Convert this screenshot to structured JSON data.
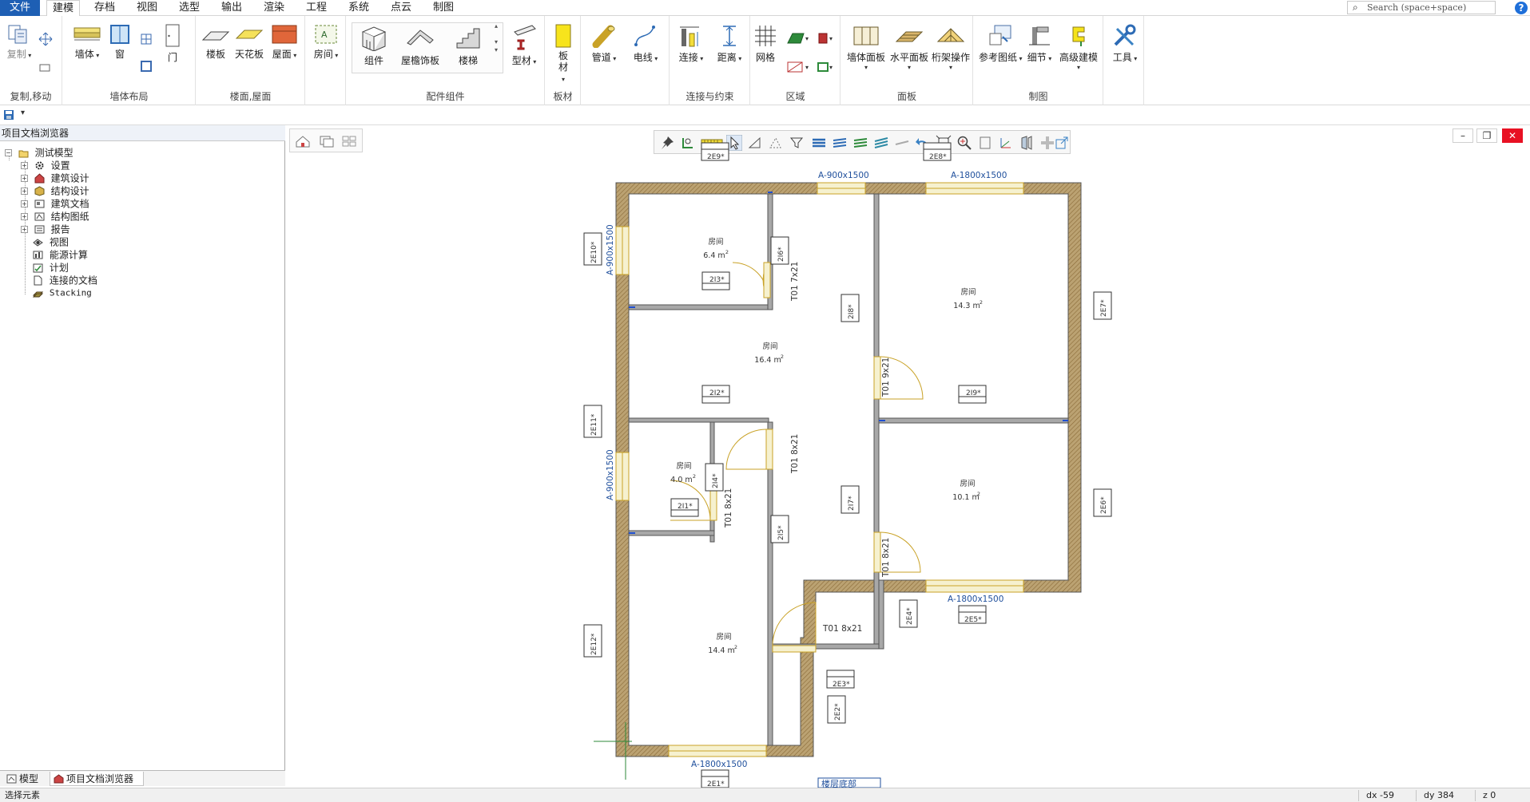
{
  "tabs": [
    "文件",
    "建模",
    "存档",
    "视图",
    "选型",
    "输出",
    "渲染",
    "工程",
    "系统",
    "点云",
    "制图"
  ],
  "active_tab": "建模",
  "search": {
    "placeholder": "Search (space+space)"
  },
  "ribbon": {
    "groups": {
      "copy_move": "复制,移动",
      "wall_layout": "墙体布局",
      "floor_roof": "楼面,屋面",
      "components": "配件组件",
      "board": "板材",
      "connect_constraint": "连接与约束",
      "region": "区域",
      "panel": "面板",
      "drawing": "制图"
    },
    "buttons": {
      "copy": "复制",
      "wall": "墙体",
      "window": "窗",
      "door": "门",
      "floor": "楼板",
      "ceiling": "天花板",
      "roof": "屋面",
      "room": "房间",
      "component": "组件",
      "roof_decor": "屋檐饰板",
      "stair": "楼梯",
      "profile": "型材",
      "board": "板材",
      "pipe": "管道",
      "cable": "电线",
      "connect": "连接",
      "distance": "距离",
      "grid": "网格",
      "wall_panel": "墙体面板",
      "floor_panel": "水平面板",
      "truss": "桁架操作",
      "ref_drawing": "参考图纸",
      "detail": "细节",
      "advanced": "高级建模",
      "tools": "工具"
    }
  },
  "left_panel": {
    "header": "项目文档浏览器",
    "tree": [
      {
        "label": "测试模型",
        "level": 0,
        "expander": "minus"
      },
      {
        "label": "设置",
        "level": 1,
        "expander": "plus"
      },
      {
        "label": "建筑设计",
        "level": 1,
        "expander": "plus"
      },
      {
        "label": "结构设计",
        "level": 1,
        "expander": "plus"
      },
      {
        "label": "建筑文档",
        "level": 1,
        "expander": "plus"
      },
      {
        "label": "结构图纸",
        "level": 1,
        "expander": "plus"
      },
      {
        "label": "报告",
        "level": 1,
        "expander": "plus"
      },
      {
        "label": "视图",
        "level": 1,
        "expander": "none"
      },
      {
        "label": "能源计算",
        "level": 1,
        "expander": "none"
      },
      {
        "label": "计划",
        "level": 1,
        "expander": "none"
      },
      {
        "label": "连接的文档",
        "level": 1,
        "expander": "none"
      },
      {
        "label": "Stacking",
        "level": 1,
        "expander": "none"
      }
    ],
    "bottom_tabs": [
      "模型",
      "项目文档浏览器"
    ]
  },
  "plan": {
    "windows": [
      "A-900x1500",
      "A-1800x1500",
      "A-900x1500",
      "A-900x1500",
      "A-1800x1500",
      "A-1800x1500"
    ],
    "doors": [
      "T01 7x21",
      "T01 9x21",
      "T01 8x21",
      "T01 8x21",
      "T01 8x21",
      "T01 8x21"
    ],
    "room_name": "房间",
    "rooms": [
      {
        "name": "房间",
        "area": "6.4 m",
        "tag": "2I3*"
      },
      {
        "name": "房间",
        "area": "16.4 m",
        "tag": "2I2*"
      },
      {
        "name": "房间",
        "area": "14.3 m",
        "tag": "2I9*"
      },
      {
        "name": "房间",
        "area": "4.0 m",
        "tag": "2I1*"
      },
      {
        "name": "房间",
        "area": "10.1 m",
        "tag": ""
      },
      {
        "name": "房间",
        "area": "14.4 m",
        "tag": ""
      }
    ],
    "exterior_tags": [
      "2E9*",
      "2E8*",
      "2E10*",
      "2E7*",
      "2E11*",
      "2E6*",
      "2E12*",
      "2E4*",
      "2E5*",
      "2E3*",
      "2E2*",
      "2E1*"
    ],
    "interior_tags": [
      "2I6*",
      "2I8*",
      "2I4*",
      "2I5*",
      "2I7*"
    ],
    "superscript": "2",
    "bottom_label": "楼层底部"
  },
  "status": {
    "left": "选择元素",
    "dx": "dx -59",
    "dy": "dy 384",
    "z": "z 0"
  },
  "colors": {
    "file_tab": "#1e5fb4",
    "wall_hatch": "#a88a55",
    "wall_line": "#555555",
    "window": "#d8d0a0",
    "plan_text_blue": "#1f4f9c",
    "close_button": "#e81123"
  }
}
